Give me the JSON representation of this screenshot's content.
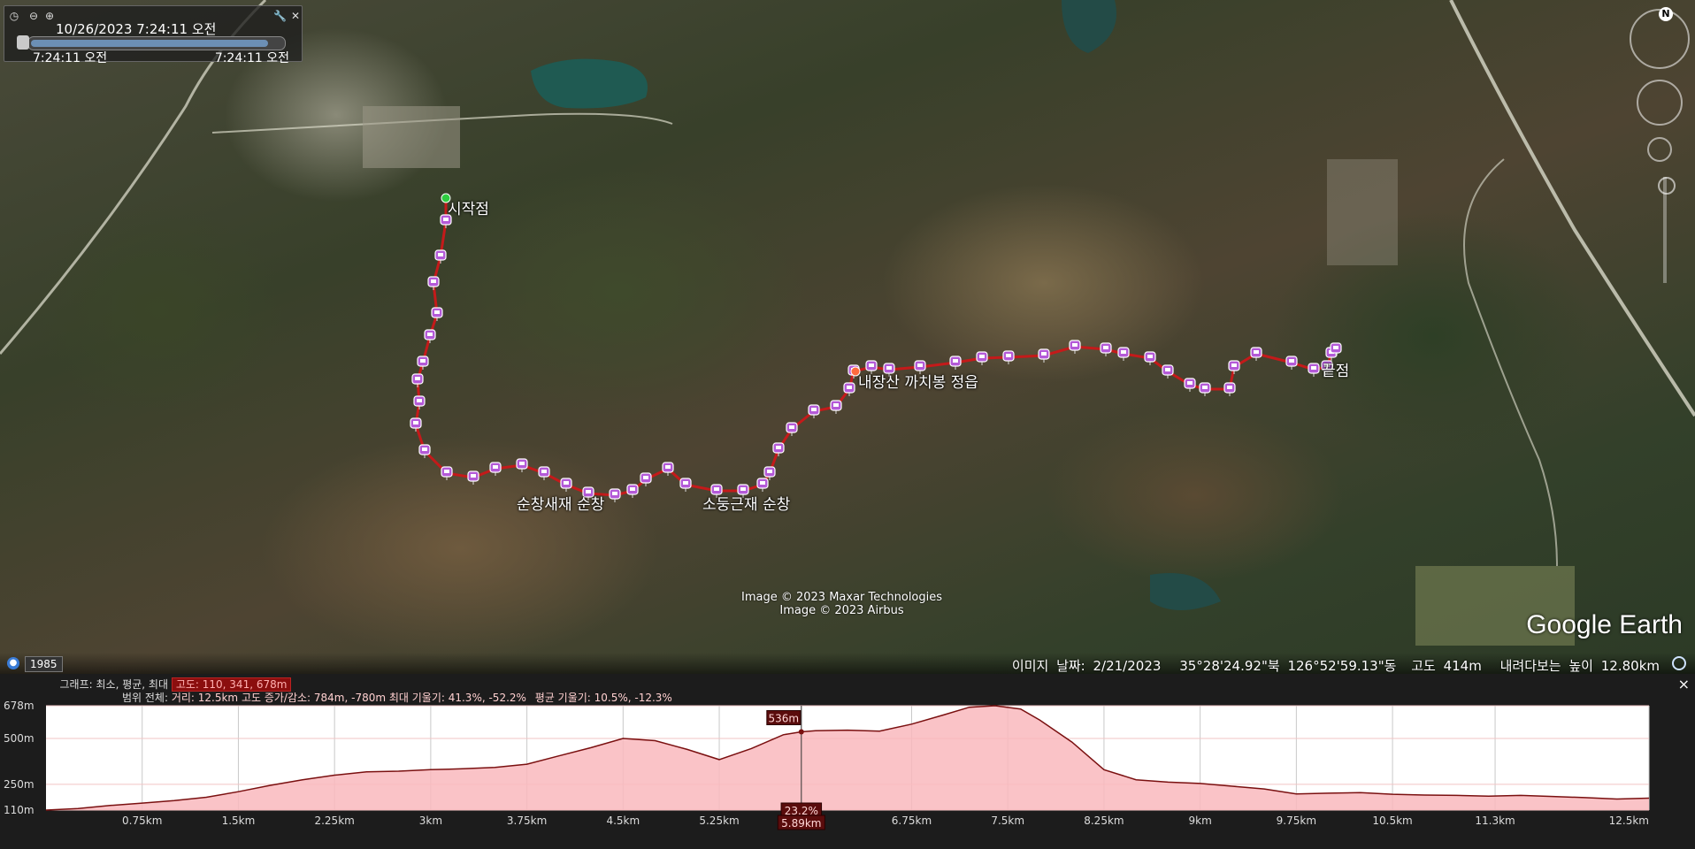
{
  "time_slider": {
    "current": "10/26/2023    7:24:11 오전",
    "start": "7:24:11 오전",
    "end": "7:24:11 오전"
  },
  "map_labels": {
    "start": "시작점",
    "saddle1": "순창새재 순창",
    "saddle2": "소둥근재 순창",
    "peak": "내장산 까치봉 정읍",
    "end": "끝점"
  },
  "copyright": {
    "line1": "Image © 2023 Maxar Technologies",
    "line2": "Image © 2023 Airbus"
  },
  "logo": "Google Earth",
  "history_year": "1985",
  "status_bar": {
    "date": "이미지 날짜: 2/21/2023",
    "lat": "35°28'24.92\"북",
    "lon": "126°52'59.13\"동",
    "elev": "고도  414m",
    "eye": "내려다보는 높이  12.80km"
  },
  "nav": {
    "north": "N"
  },
  "elevation_profile": {
    "graph_label": "그래프: 최소, 평균, 최대",
    "graph_values": "고도: 110, 341, 678m",
    "range_label": "범위 전체:",
    "range_values_1": "거리: 12.5km 고도 증가/감소: 784m, -780m 최대 기울기: 41.3%, -52.2%",
    "range_values_2": "평균 기울기: 10.5%, -12.3%",
    "close": "×",
    "y_ticks": [
      {
        "label": "678m",
        "v": 678
      },
      {
        "label": "500m",
        "v": 500
      },
      {
        "label": "250m",
        "v": 250
      },
      {
        "label": "110m",
        "v": 110
      }
    ],
    "x_ticks": [
      "0.75km",
      "1.5km",
      "2.25km",
      "3km",
      "3.75km",
      "4.5km",
      "5.25km",
      "5.89km",
      "6.75km",
      "7.5km",
      "8.25km",
      "9km",
      "9.75km",
      "10.5km",
      "11.3km",
      "12.5km"
    ],
    "cursor": {
      "distance_km": 5.89,
      "elevation_label": "536m",
      "slope_label": "23.2%",
      "distance_label": "5.89km"
    }
  },
  "chart_data": {
    "type": "area",
    "title": "",
    "xlabel": "",
    "ylabel": "",
    "xlim": [
      0,
      12.5
    ],
    "ylim": [
      110,
      678
    ],
    "grid": true,
    "series": [
      {
        "x": [
          0,
          0.25,
          0.5,
          0.75,
          1.0,
          1.25,
          1.5,
          1.75,
          2.0,
          2.25,
          2.5,
          2.75,
          3.0,
          3.25,
          3.5,
          3.75,
          4.0,
          4.25,
          4.5,
          4.75,
          5.0,
          5.25,
          5.5,
          5.75,
          5.89,
          6.0,
          6.25,
          6.5,
          6.75,
          7.0,
          7.2,
          7.4,
          7.6,
          7.75,
          8.0,
          8.25,
          8.5,
          8.75,
          9.0,
          9.25,
          9.5,
          9.75,
          10.0,
          10.25,
          10.5,
          10.75,
          11.0,
          11.25,
          11.5,
          11.75,
          12.0,
          12.25,
          12.5
        ],
        "values": [
          110,
          118,
          135,
          148,
          162,
          180,
          210,
          245,
          275,
          300,
          318,
          322,
          330,
          335,
          342,
          360,
          405,
          450,
          500,
          488,
          440,
          385,
          445,
          520,
          536,
          542,
          545,
          540,
          578,
          628,
          670,
          678,
          660,
          600,
          480,
          330,
          275,
          262,
          255,
          240,
          225,
          198,
          202,
          205,
          196,
          192,
          190,
          186,
          190,
          184,
          178,
          170,
          175
        ]
      }
    ]
  }
}
